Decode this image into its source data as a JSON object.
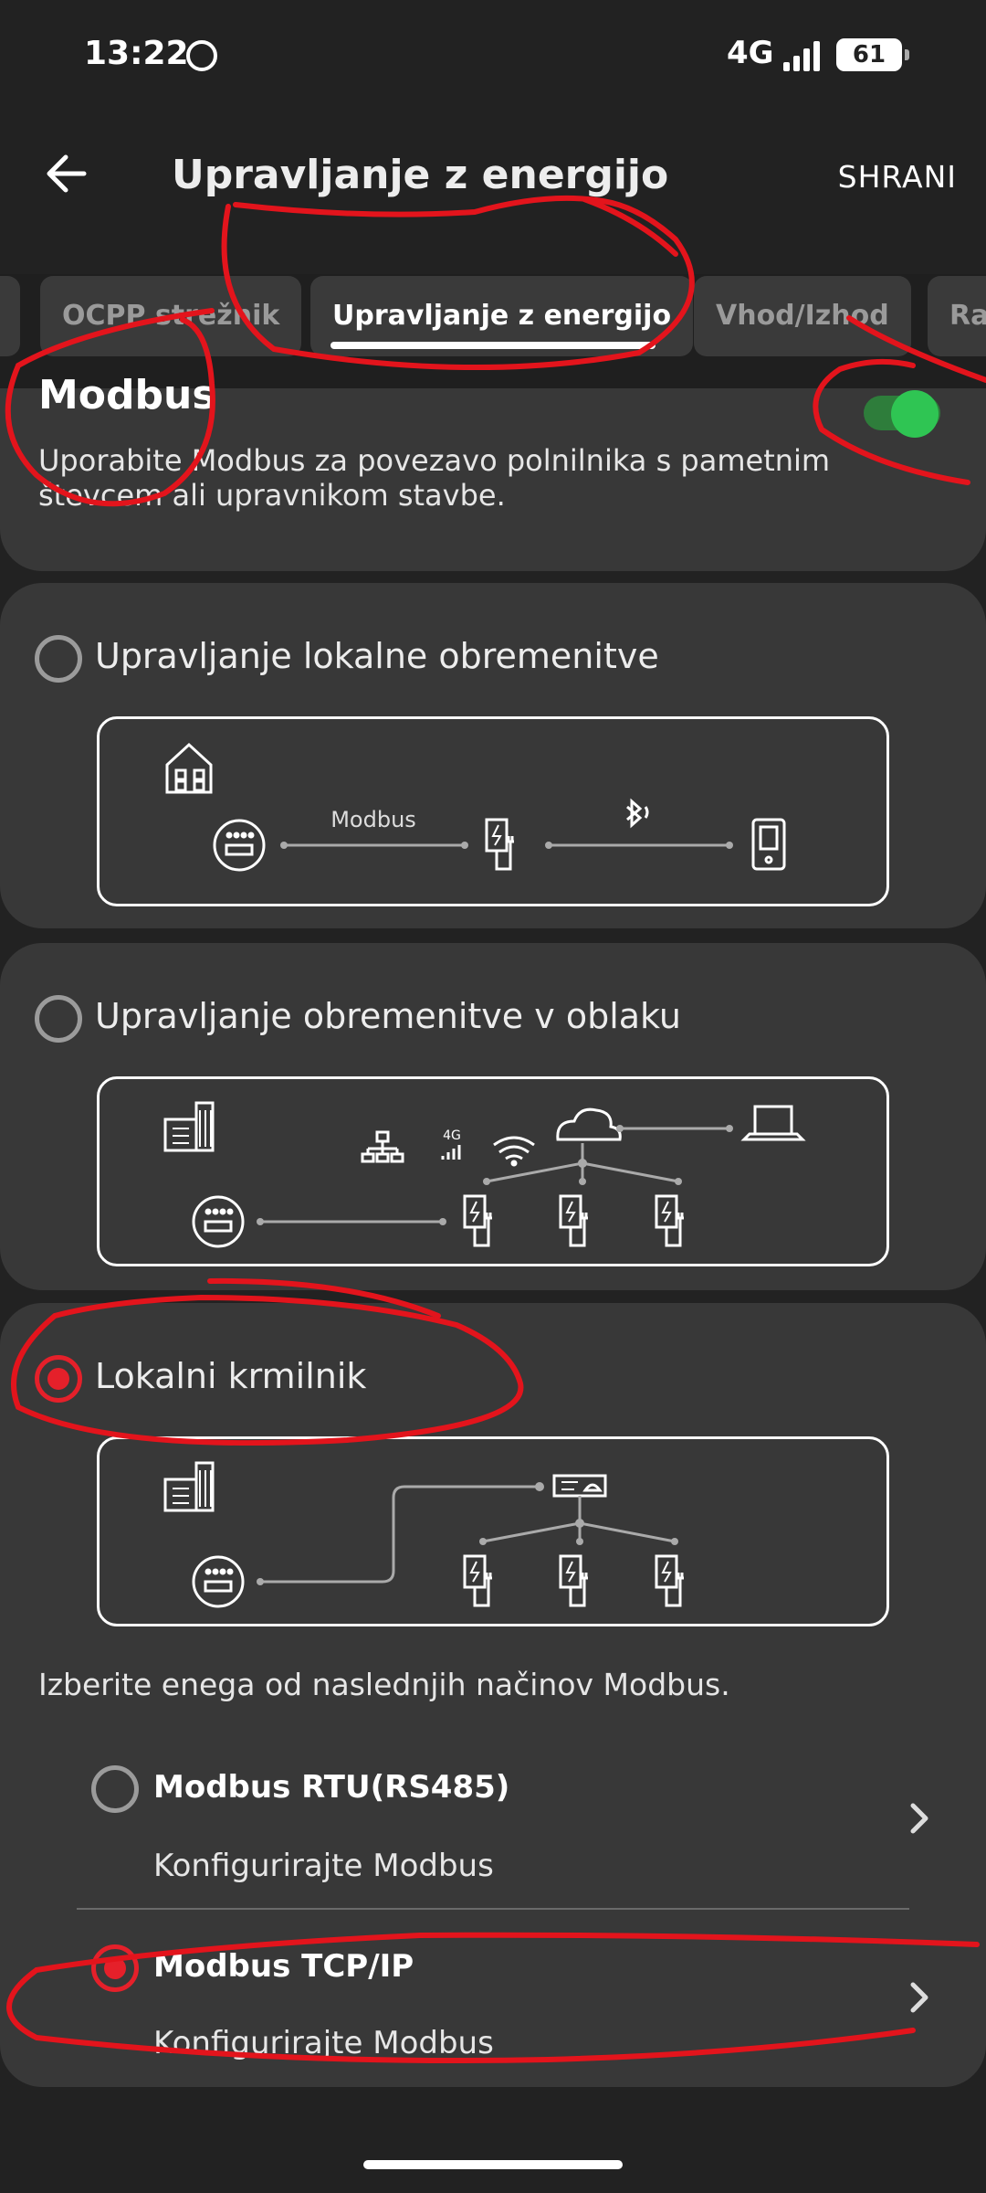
{
  "status_bar": {
    "time": "13:22",
    "network": "4G",
    "battery": "61"
  },
  "app_bar": {
    "title": "Upravljanje z energijo",
    "save_label": "SHRANI"
  },
  "tabs": [
    {
      "label": "OCPP strežnik"
    },
    {
      "label": "Upravljanje z energijo",
      "active": true
    },
    {
      "label": "Vhod/Izhod"
    },
    {
      "label": "Raz"
    }
  ],
  "modbus": {
    "title": "Modbus",
    "enabled": true,
    "description": "Uporabite Modbus za povezavo polnilnika s pametnim števcem ali upravnikom stavbe."
  },
  "options": [
    {
      "label": "Upravljanje lokalne obremenitve",
      "selected": false,
      "diagram_label": "Modbus"
    },
    {
      "label": "Upravljanje obremenitve v oblaku",
      "selected": false,
      "diagram_label": "4G"
    },
    {
      "label": "Lokalni krmilnik",
      "selected": true
    }
  ],
  "modbus_modes": {
    "helper": "Izberite enega od naslednjih načinov Modbus.",
    "items": [
      {
        "title": "Modbus RTU(RS485)",
        "subtitle": "Konfigurirajte Modbus",
        "selected": false
      },
      {
        "title": "Modbus TCP/IP",
        "subtitle": "Konfigurirajte Modbus",
        "selected": true
      }
    ]
  },
  "colors": {
    "accent_red": "#e5202a",
    "toggle_green": "#2fc553",
    "card_bg": "#383838",
    "page_bg": "#222222"
  }
}
